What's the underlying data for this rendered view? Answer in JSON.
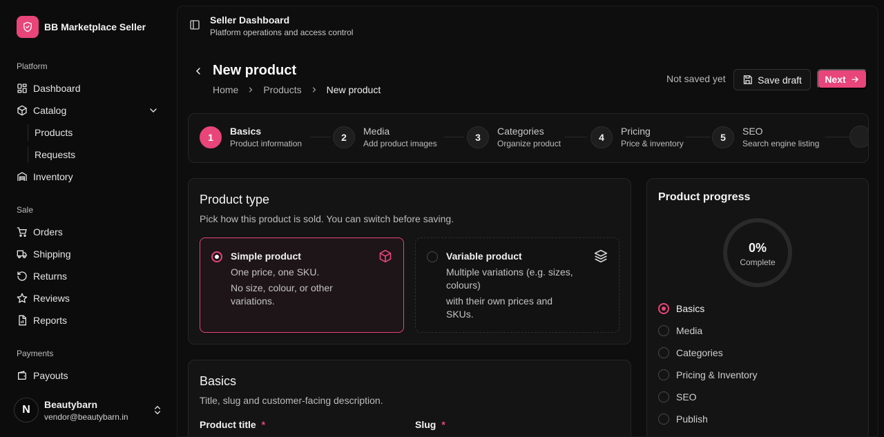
{
  "brand": {
    "name": "BB Marketplace Seller",
    "accent": "#e8457a"
  },
  "sidebar": {
    "sections": {
      "platform": "Platform",
      "sale": "Sale",
      "payments": "Payments"
    },
    "items": {
      "dashboard": "Dashboard",
      "catalog": "Catalog",
      "products": "Products",
      "requests": "Requests",
      "inventory": "Inventory",
      "orders": "Orders",
      "shipping": "Shipping",
      "returns": "Returns",
      "reviews": "Reviews",
      "reports": "Reports",
      "payouts": "Payouts"
    },
    "user": {
      "initial": "N",
      "name": "Beautybarn",
      "email": "vendor@beautybarn.in"
    }
  },
  "topbar": {
    "title": "Seller Dashboard",
    "subtitle": "Platform operations and access control"
  },
  "page": {
    "title": "New product",
    "breadcrumb": [
      "Home",
      "Products",
      "New product"
    ],
    "status": "Not saved yet",
    "save_draft": "Save draft",
    "next": "Next"
  },
  "stepper": [
    {
      "num": "1",
      "title": "Basics",
      "sub": "Product information"
    },
    {
      "num": "2",
      "title": "Media",
      "sub": "Add product images"
    },
    {
      "num": "3",
      "title": "Categories",
      "sub": "Organize product"
    },
    {
      "num": "4",
      "title": "Pricing",
      "sub": "Price & inventory"
    },
    {
      "num": "5",
      "title": "SEO",
      "sub": "Search engine listing"
    }
  ],
  "product_type": {
    "title": "Product type",
    "subtitle": "Pick how this product is sold. You can switch before saving.",
    "simple": {
      "title": "Simple product",
      "line1": "One price, one SKU.",
      "line2": "No size, colour, or other variations."
    },
    "variable": {
      "title": "Variable product",
      "line1": "Multiple variations (e.g. sizes, colours)",
      "line2": "with their own prices and SKUs."
    }
  },
  "basics": {
    "title": "Basics",
    "subtitle": "Title, slug and customer-facing description.",
    "product_title_label": "Product title",
    "slug_label": "Slug",
    "required_mark": "*"
  },
  "progress": {
    "title": "Product progress",
    "percent": "0%",
    "percent_value": 0,
    "label": "Complete",
    "items": [
      "Basics",
      "Media",
      "Categories",
      "Pricing & Inventory",
      "SEO",
      "Publish"
    ]
  }
}
